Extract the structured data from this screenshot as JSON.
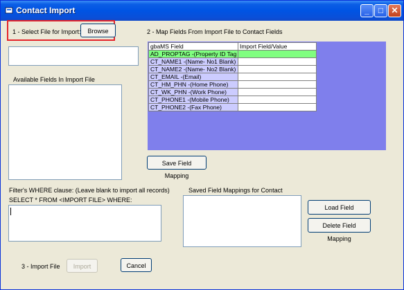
{
  "window": {
    "title": "Contact Import"
  },
  "step1": {
    "label": "1 - Select File for Import:",
    "browse_button": "Browse"
  },
  "step2": {
    "label": "2 - Map Fields From Import File to Contact Fields"
  },
  "available_fields": {
    "label": "Available Fields In Import File"
  },
  "mapping_grid": {
    "headers": [
      "gbaMS Field",
      "Import Field/Value"
    ],
    "rows": [
      {
        "field": "AD_PROPTAG -(Property ID Tag",
        "value": ""
      },
      {
        "field": "CT_NAME1 -(Name- No1 Blank)",
        "value": ""
      },
      {
        "field": "CT_NAME2 -(Name- No2 Blank)",
        "value": ""
      },
      {
        "field": "CT_EMAIL -(Email)",
        "value": ""
      },
      {
        "field": "CT_HM_PHN -(Home Phone)",
        "value": ""
      },
      {
        "field": "CT_WK_PHN -(Work Phone)",
        "value": ""
      },
      {
        "field": "CT_PHONE1 -(Mobile Phone)",
        "value": ""
      },
      {
        "field": "CT_PHONE2 -(Fax Phone)",
        "value": ""
      }
    ],
    "selected_row": 0
  },
  "save_mapping_button": "Save Field Mapping",
  "filter": {
    "label": "Filter's WHERE clause:  (Leave blank to import all records)",
    "sql_prefix": "SELECT * FROM <IMPORT FILE> WHERE:"
  },
  "saved_mappings": {
    "label": "Saved Field Mappings for Contact"
  },
  "load_mapping_button": "Load Field Mapping",
  "delete_mapping_button": "Delete Field Mapping",
  "step3": {
    "label": "3 - Import File",
    "import_button": "Import",
    "cancel_button": "Cancel"
  },
  "colors": {
    "titlebar": "#0054e3",
    "grid_background": "#7f7fec",
    "selected_row": "#80ff80",
    "field_cell": "#ccccff",
    "highlight_border": "#e6242a"
  }
}
